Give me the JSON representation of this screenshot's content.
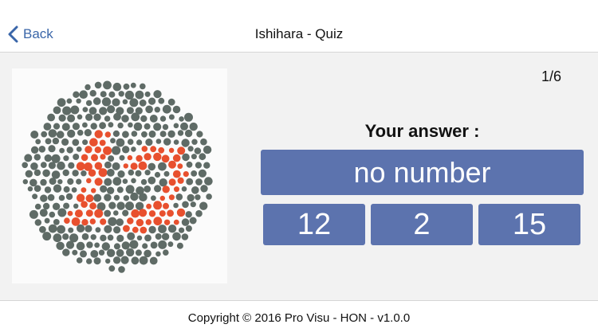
{
  "nav": {
    "back_label": "Back",
    "title": "Ishihara - Quiz"
  },
  "quiz": {
    "counter": "1/6",
    "prompt": "Your answer :",
    "options": [
      "no number",
      "12",
      "2",
      "15"
    ]
  },
  "plate": {
    "background_dot_color": "#5f6b66",
    "figure_dot_color": "#e8502e"
  },
  "footer": {
    "copyright": "Copyright © 2016 Pro Visu - HON - v1.0.0"
  },
  "colors": {
    "accent": "#3a66a9",
    "button": "#5c73ae"
  }
}
